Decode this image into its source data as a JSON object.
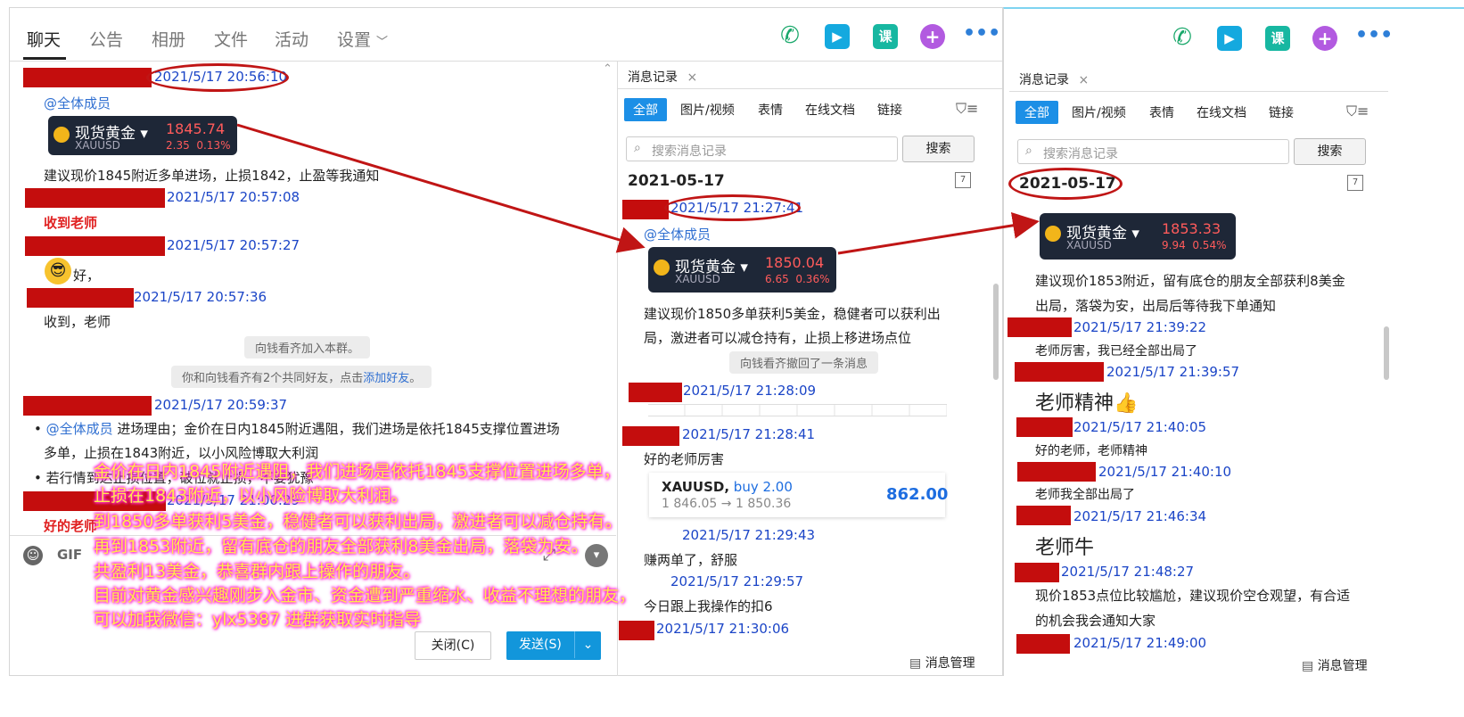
{
  "main_tabs": {
    "chat": "聊天",
    "notice": "公告",
    "album": "相册",
    "files": "文件",
    "activity": "活动",
    "settings": "设置"
  },
  "chat": {
    "t1": "2021/5/17 20:56:10",
    "mention_all": "@全体成员",
    "msg1": "建议现价1845附近多单进场，止损1842，止盈等我通知",
    "t2": "2021/5/17 20:57:08",
    "msg2": "收到老师",
    "t3": "2021/5/17 20:57:27",
    "msg3": "好，",
    "t4": "2021/5/17 20:57:36",
    "msg4": "收到，老师",
    "sys1": "向钱看齐加入本群。",
    "sys2_pre": "你和向钱看齐有2个共同好友，点击",
    "sys2_link": "添加好友",
    "sys2_post": "。",
    "t5": "2021/5/17 20:59:37",
    "msg5_mention": "@全体成员",
    "msg5a": " 进场理由；金价在日内1845附近遇阻，我们进场是依托1845支撑位置进场",
    "msg5b": "多单，止损在1843附近，以小风险博取大利润",
    "msg5c": "若行情到达止损位置，破位就止损，不要犹豫",
    "t6": "2021/5/17 21:00:29",
    "msg6": "好的老师",
    "gif": "GIF",
    "close_btn": "关闭(C)",
    "send_btn": "发送(S)"
  },
  "quotes": [
    {
      "name": "现货黄金",
      "symbol": "XAUUSD",
      "price": "1845.74",
      "change": "2.35",
      "pct": "0.13%"
    },
    {
      "name": "现货黄金",
      "symbol": "XAUUSD",
      "price": "1850.04",
      "change": "6.65",
      "pct": "0.36%"
    },
    {
      "name": "现货黄金",
      "symbol": "XAUUSD",
      "price": "1853.33",
      "change": "9.94",
      "pct": "0.54%"
    }
  ],
  "history": {
    "title": "消息记录",
    "filters": [
      "全部",
      "图片/视频",
      "表情",
      "在线文档",
      "链接"
    ],
    "search_placeholder": "搜索消息记录",
    "search_btn": "搜索",
    "date": "2021-05-17",
    "manage": "消息管理"
  },
  "mid": {
    "t1": "2021/5/17 21:27:41",
    "mention": "@全体成员",
    "msg1a": "建议现价1850多单获利5美金，稳健者可以获利出",
    "msg1b": "局，激进者可以减仓持有，止损上移进场点位",
    "sys": "向钱看齐撤回了一条消息",
    "t2": "2021/5/17 21:28:09",
    "t3": "2021/5/17 21:28:41",
    "msg3": "好的老师厉害",
    "trade_symbol": "XAUUSD,",
    "trade_side": " buy 2.00",
    "trade_prices": "1 846.05 → 1 850.36",
    "trade_profit": "862.00",
    "t4": "2021/5/17 21:29:43",
    "msg4": "赚两单了，舒服",
    "t5": "2021/5/17 21:29:57",
    "msg5": "今日跟上我操作的扣6",
    "t6": "2021/5/17 21:30:06"
  },
  "right": {
    "msg1a": "建议现价1853附近，留有底仓的朋友全部获利8美金",
    "msg1b": "出局，落袋为安，出局后等待我下单通知",
    "t1": "2021/5/17 21:39:22",
    "msg2": "老师厉害，我已经全部出局了",
    "t2": "2021/5/17 21:39:57",
    "msg3": "老师精神👍",
    "t3": "2021/5/17 21:40:05",
    "msg4": "好的老师，老师精神",
    "t4": "2021/5/17 21:40:10",
    "msg5": "老师我全部出局了",
    "t5": "2021/5/17 21:46:34",
    "msg6": "老师牛",
    "t6": "2021/5/17 21:48:27",
    "msg7a": "现价1853点位比较尴尬，建议现价空仓观望，有合适",
    "msg7b": "的机会我会通知大家",
    "t7": "2021/5/17 21:49:00"
  },
  "overlay": [
    "金价在日内1845附近遇阻，我们进场是依托1845支撑位置进场多单，",
    "止损在1843附近，以小风险博取大利润。",
    "到1850多单获利5美金，稳健者可以获利出局，激进者可以减仓持有。",
    "再到1853附近，留有底仓的朋友全部获利8美金出局，落袋为安。",
    "共盈利13美金，恭喜群内跟上操作的朋友。",
    "目前对黄金感兴趣刚步入金市、资金遭到严重缩水、收益不理想的朋友，",
    "可以加我微信：ylx5387  进群获取实时指导"
  ]
}
